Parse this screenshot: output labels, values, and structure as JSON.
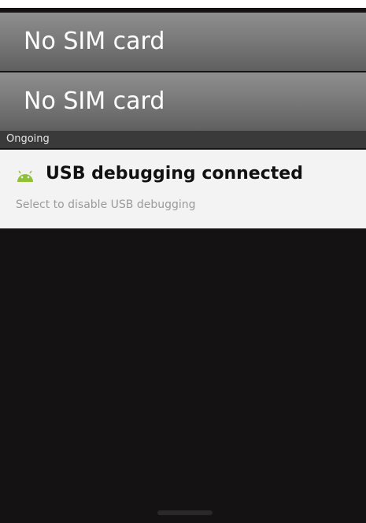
{
  "status_bar": {
    "carriers": [
      "No SIM card",
      "No SIM card"
    ]
  },
  "notifications_panel": {
    "section_label": "Ongoing",
    "items": [
      {
        "icon": "android-icon",
        "title": "USB debugging connected",
        "subtitle": "Select to disable USB debugging"
      }
    ]
  },
  "colors": {
    "carrier_bg": "#7a7a7a",
    "panel_bg": "#141212",
    "notification_bg": "#f3f3f3",
    "android_green": "#8fc23a"
  }
}
